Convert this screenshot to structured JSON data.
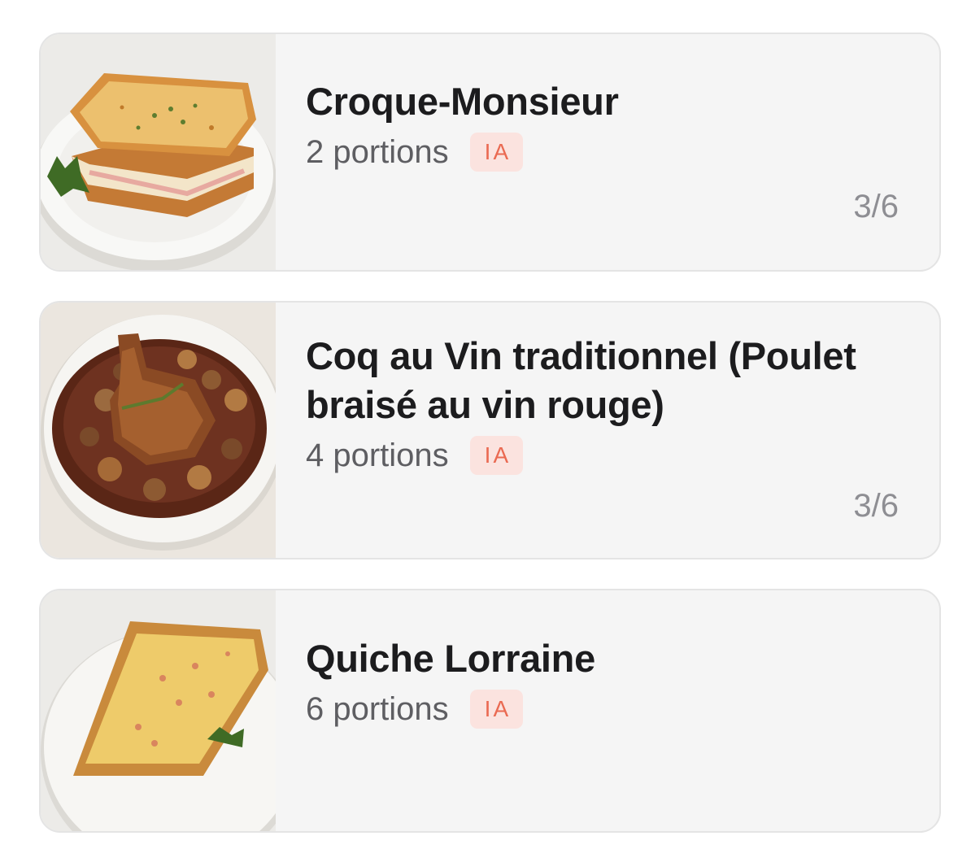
{
  "recipes": [
    {
      "title": "Croque-Monsieur",
      "portions": "2 portions",
      "badge": "IA",
      "progress": "3/6",
      "image": "croque-monsieur-photo"
    },
    {
      "title": "Coq au Vin traditionnel (Poulet braisé au vin rouge)",
      "portions": "4 portions",
      "badge": "IA",
      "progress": "3/6",
      "image": "coq-au-vin-photo"
    },
    {
      "title": "Quiche Lorraine",
      "portions": "6 portions",
      "badge": "IA",
      "image": "quiche-lorraine-photo"
    }
  ],
  "colors": {
    "card_background": "#f5f5f5",
    "card_border": "#e4e4e4",
    "badge_background": "#fbe3df",
    "badge_text": "#ea6a52",
    "title_text": "#1c1c1e",
    "secondary_text": "#5e5e62",
    "progress_text": "#8e8e93"
  }
}
